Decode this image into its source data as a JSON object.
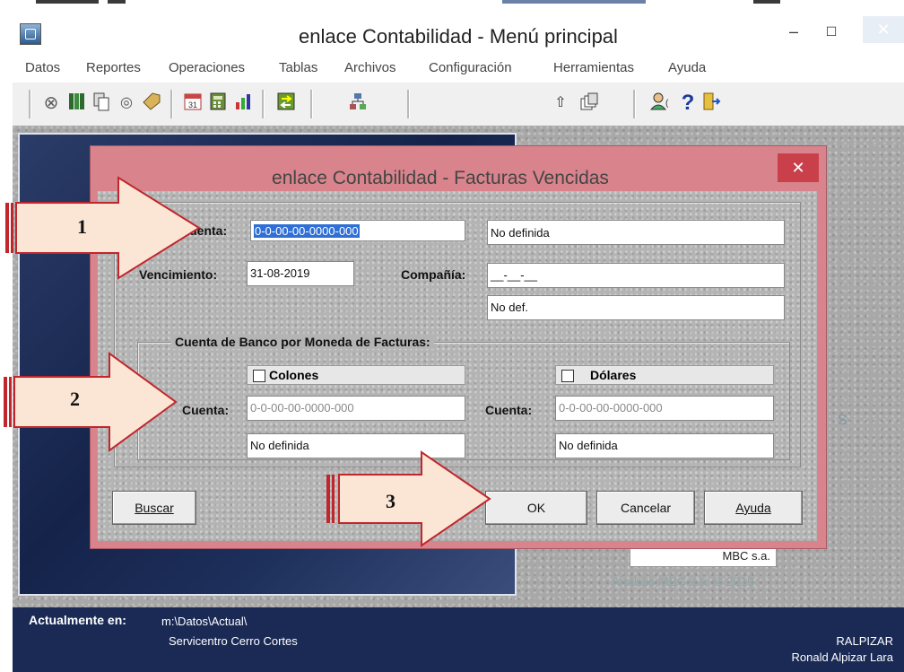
{
  "main_window": {
    "title": "enlace Contabilidad - Menú principal",
    "controls": {
      "minimize": "–",
      "maximize": "☐",
      "close": "✕"
    }
  },
  "menu": [
    "Datos",
    "Reportes",
    "Operaciones",
    "Tablas",
    "Archivos",
    "Configuración",
    "Herramientas",
    "Ayuda"
  ],
  "toolbar": {
    "icons": [
      "binoculars-icon",
      "book-icon",
      "copy-icon",
      "search-book-icon",
      "tag-icon",
      "calendar-icon",
      "calculator-icon",
      "chart-icon",
      "exchange-icon",
      "sitemap-icon",
      "arrow-up-icon",
      "windows-icon",
      "user-icon",
      "help-icon",
      "exit-door-icon"
    ]
  },
  "dialog": {
    "title": "enlace Contabilidad - Facturas Vencidas",
    "close": "✕",
    "cuenta_label": "Cuenta:",
    "cuenta_value": "0-0-00-00-0000-000",
    "cuenta_desc": "No definida",
    "vencimiento_label": "Vencimiento:",
    "vencimiento_value": "31-08-2019",
    "compania_label": "Compañía:",
    "compania_value": "__-__-__",
    "compania_desc": "No def.",
    "bank_group_title": "Cuenta de Banco por Moneda de Facturas:",
    "colones": {
      "header": "Colones",
      "cuenta_label": "Cuenta:",
      "cuenta_value": "0-0-00-00-0000-000",
      "desc": "No definida",
      "checked": false
    },
    "dolares": {
      "header": "Dólares",
      "cuenta_label": "Cuenta:",
      "cuenta_value": "0-0-00-00-0000-000",
      "desc": "No definida",
      "checked": false
    },
    "buttons": {
      "buscar": "Buscar",
      "ok": "OK",
      "cancelar": "Cancelar",
      "ayuda": "Ayuda"
    }
  },
  "callouts": [
    "1",
    "2",
    "3"
  ],
  "background": {
    "mbc": "MBC s.a.",
    "copyright": "Análisis MBC s.a. © 2019",
    "edge_letter": "S"
  },
  "statusbar": {
    "label": "Actualmente en:",
    "path": "m:\\Datos\\Actual\\",
    "company": "Servicentro Cerro Cortes",
    "user_code": "RALPIZAR",
    "user_name": "Ronald Alpizar Lara"
  },
  "colors": {
    "dialog_frame": "#d9848d",
    "close_red": "#c9404a",
    "statusbar": "#1a2a55",
    "selection": "#2f6fd6",
    "callout_fill": "#fbe6d6",
    "callout_border": "#c0262c"
  }
}
